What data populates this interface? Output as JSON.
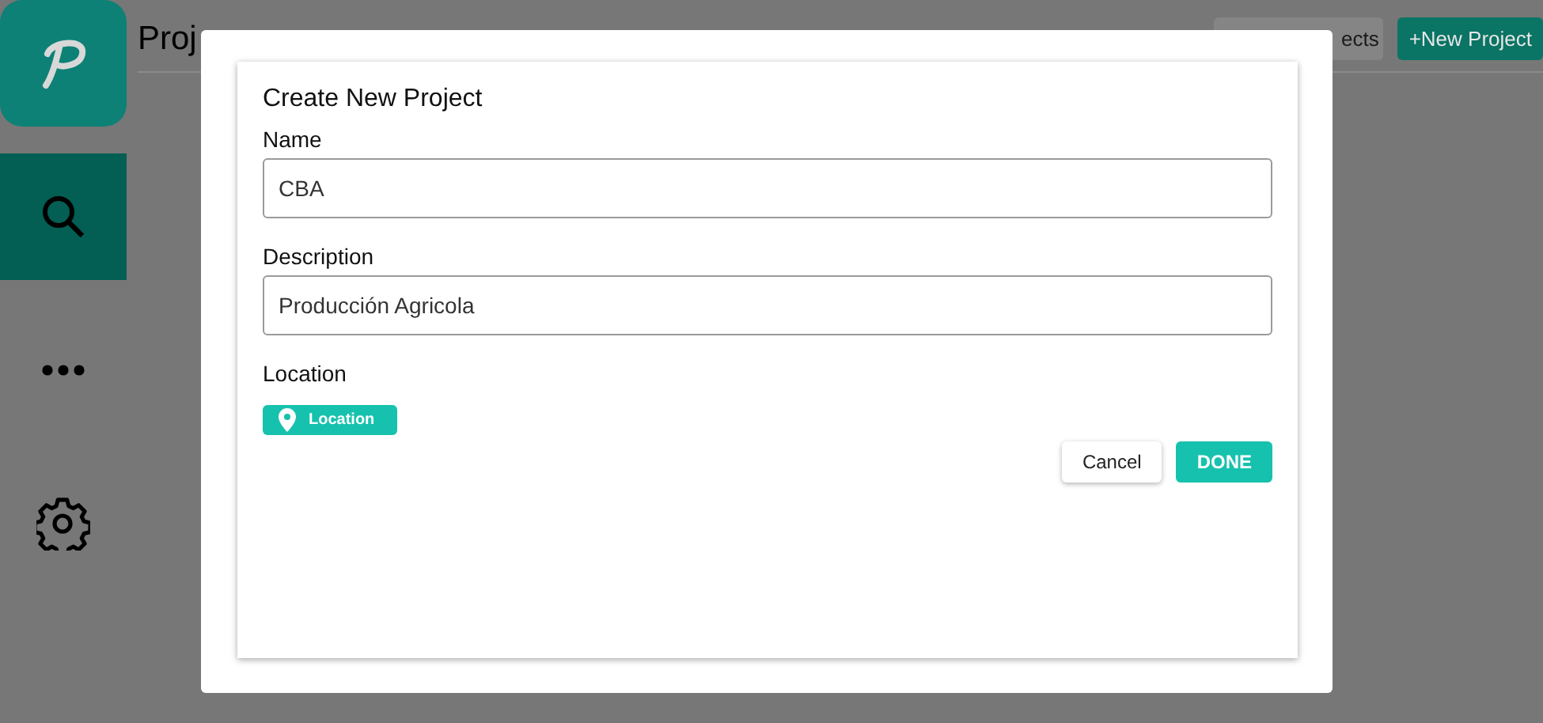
{
  "sidebar": {
    "items": [
      {
        "kind": "logo",
        "selected": false
      },
      {
        "kind": "search",
        "selected": true
      },
      {
        "kind": "more",
        "selected": false
      },
      {
        "kind": "settings",
        "selected": false
      }
    ]
  },
  "header": {
    "title": "Proj",
    "shared_button": "ects",
    "new_button": "+New Project"
  },
  "dialog": {
    "title": "Create New Project",
    "fields": [
      {
        "label": "Name",
        "value": "CBA"
      },
      {
        "label": "Description",
        "value": "Producción Agricola"
      }
    ],
    "location": {
      "label": "Location",
      "button": "Location"
    },
    "buttons": [
      {
        "label": "Cancel",
        "kind": "secondary"
      },
      {
        "label": "DONE",
        "kind": "primary"
      }
    ]
  }
}
